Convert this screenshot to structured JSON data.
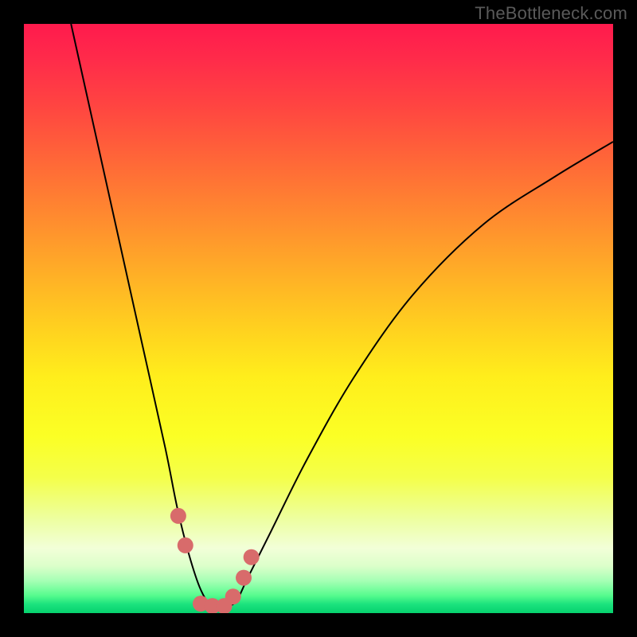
{
  "watermark": "TheBottleneck.com",
  "chart_data": {
    "type": "line",
    "title": "",
    "xlabel": "",
    "ylabel": "",
    "xlim": [
      0,
      100
    ],
    "ylim": [
      0,
      100
    ],
    "series": [
      {
        "name": "bottleneck-curve",
        "x": [
          8,
          12,
          16,
          20,
          24,
          26,
          28,
          30,
          32,
          34,
          36,
          38,
          42,
          48,
          56,
          66,
          78,
          90,
          100
        ],
        "values": [
          100,
          82,
          64,
          46,
          28,
          18,
          10,
          4,
          1,
          1,
          2,
          6,
          14,
          26,
          40,
          54,
          66,
          74,
          80
        ]
      }
    ],
    "markers": {
      "name": "highlight-points",
      "color": "#d86b6b",
      "x": [
        26.2,
        27.4,
        30,
        32,
        34,
        35.5,
        37.3,
        38.6
      ],
      "values": [
        16.5,
        11.5,
        1.6,
        1.2,
        1.2,
        2.8,
        6.0,
        9.5
      ]
    },
    "marker_radius": 10
  }
}
